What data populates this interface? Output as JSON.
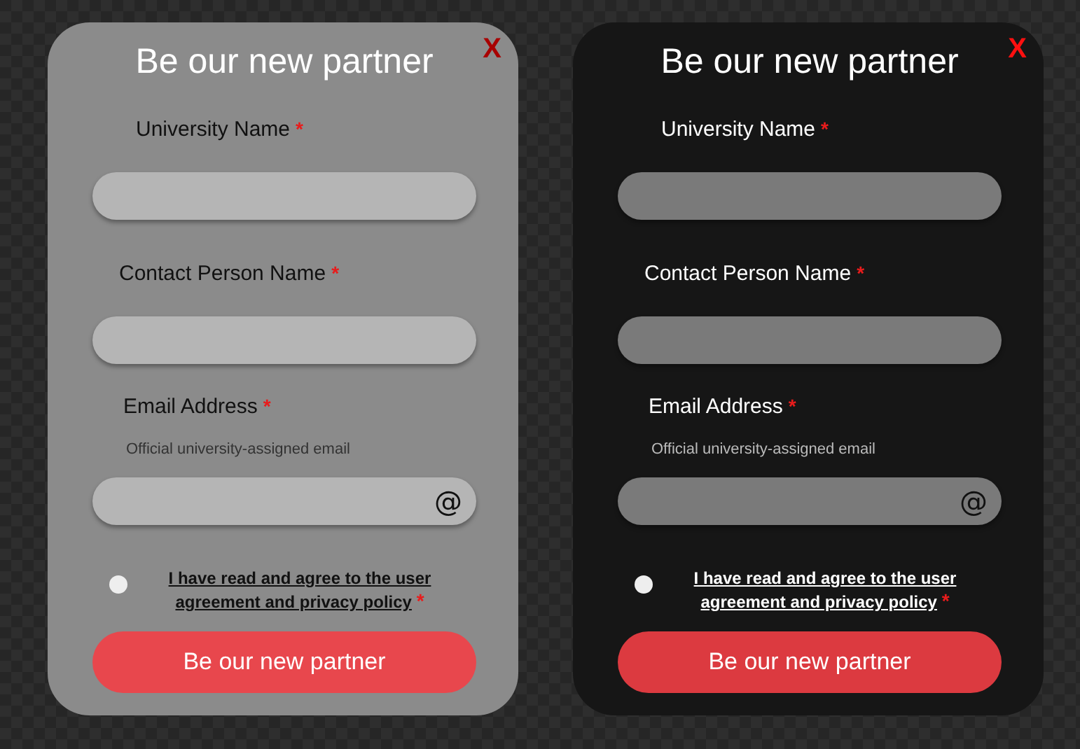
{
  "cards": [
    {
      "kind": "light",
      "title": "Be our new partner",
      "close": "X",
      "fields": [
        {
          "label": "University Name",
          "required_mark": "*"
        },
        {
          "label": "Contact Person Name",
          "required_mark": "*"
        },
        {
          "label": "Email Address",
          "required_mark": "*",
          "hint": "Official university-assigned email",
          "suffix": "@"
        }
      ],
      "agreement": {
        "checked": false,
        "text": "I have read and agree to the user agreement and privacy policy",
        "required_mark": "*"
      },
      "button": "Be our new partner"
    },
    {
      "kind": "dark",
      "title": "Be our new partner",
      "close": "X",
      "fields": [
        {
          "label": "University Name",
          "required_mark": "*"
        },
        {
          "label": "Contact Person Name",
          "required_mark": "*"
        },
        {
          "label": "Email Address",
          "required_mark": "*",
          "hint": "Official university-assigned email",
          "suffix": "@"
        }
      ],
      "agreement": {
        "checked": false,
        "text": "I have read and agree to the user agreement and privacy policy",
        "required_mark": "*"
      },
      "button": "Be our new partner"
    }
  ]
}
